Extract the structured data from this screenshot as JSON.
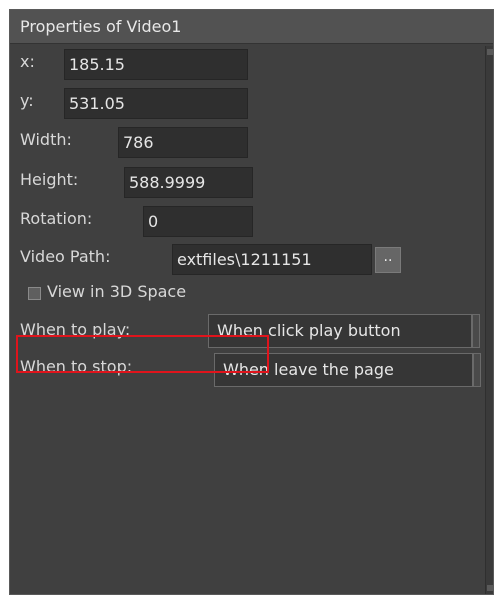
{
  "window": {
    "title": "Properties of Video1"
  },
  "fields": {
    "x": {
      "label": "x:",
      "value": "185.15"
    },
    "y": {
      "label": "y:",
      "value": "531.05"
    },
    "width": {
      "label": "Width:",
      "value": "786"
    },
    "height": {
      "label": "Height:",
      "value": "588.9999"
    },
    "rotation": {
      "label": "Rotation:",
      "value": "0"
    },
    "video_path": {
      "label": "Video Path:",
      "value": "extfiles\\1211151",
      "browse_label": ".."
    }
  },
  "view_3d": {
    "label": "View in 3D Space",
    "checked": false
  },
  "when_to_play": {
    "label": "When to play:",
    "selected": "When click play button"
  },
  "when_to_stop": {
    "label": "When to stop:",
    "selected": "When leave the page"
  },
  "colors": {
    "panel_bg": "#404040",
    "field_bg": "#2f2f2f",
    "highlight_border": "#e0141c"
  }
}
